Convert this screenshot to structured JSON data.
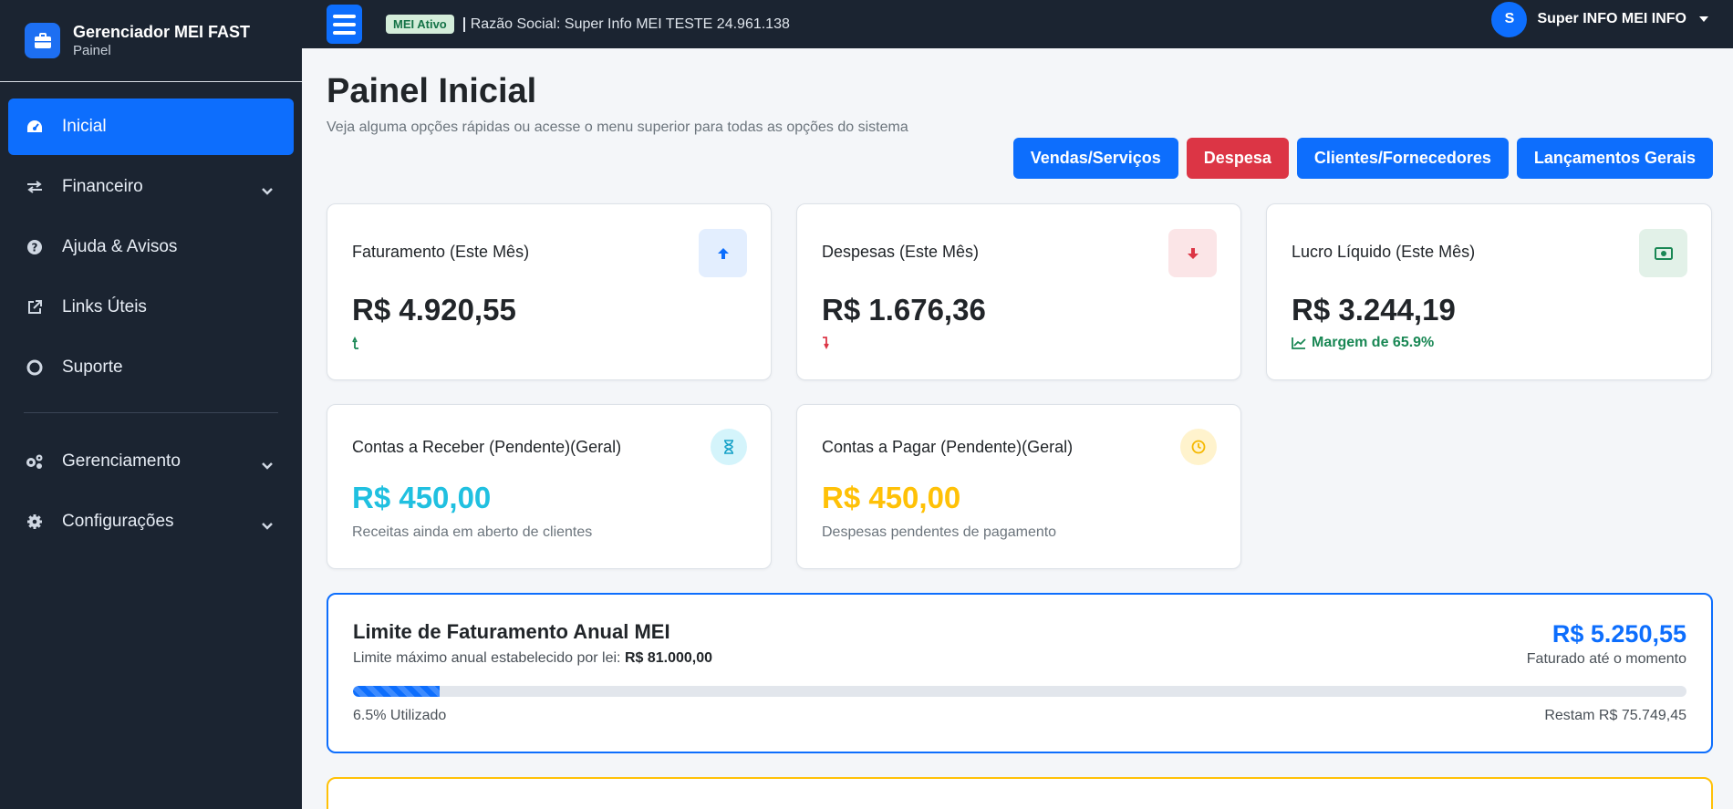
{
  "brand": {
    "title": "Gerenciador MEI FAST",
    "subtitle": "Painel"
  },
  "sidebar": {
    "items": [
      {
        "label": "Inicial",
        "icon": "gauge-icon",
        "active": true
      },
      {
        "label": "Financeiro",
        "icon": "exchange-icon",
        "dropdown": true
      },
      {
        "label": "Ajuda & Avisos",
        "icon": "question-icon"
      },
      {
        "label": "Links Úteis",
        "icon": "external-link-icon"
      },
      {
        "label": "Suporte",
        "icon": "lifebuoy-icon"
      },
      {
        "label": "Gerenciamento",
        "icon": "gears-icon",
        "dropdown": true
      },
      {
        "label": "Configurações",
        "icon": "gear-icon",
        "dropdown": true
      }
    ]
  },
  "topbar": {
    "status_badge": "MEI Ativo",
    "razao_social": "Razão Social: Super Info MEI TESTE 24.961.138",
    "user_initial": "S",
    "user_name": "Super INFO MEI INFO"
  },
  "header": {
    "title": "Painel Inicial",
    "description": "Veja alguma opções rápidas ou acesse o menu superior para todas as opções do sistema"
  },
  "actions": {
    "vendas": "Vendas/Serviços",
    "despesa": "Despesa",
    "clientes": "Clientes/Fornecedores",
    "lancamentos": "Lançamentos Gerais"
  },
  "cards": {
    "faturamento": {
      "label": "Faturamento (Este Mês)",
      "value": "R$ 4.920,55",
      "icon": "arrow-up-icon"
    },
    "despesas": {
      "label": "Despesas (Este Mês)",
      "value": "R$ 1.676,36",
      "icon": "arrow-down-icon"
    },
    "lucro": {
      "label": "Lucro Líquido (Este Mês)",
      "value": "R$ 3.244,19",
      "foot": "Margem de 65.9%",
      "icon": "money-bill-icon"
    },
    "receber": {
      "label": "Contas a Receber (Pendente)(Geral)",
      "value": "R$ 450,00",
      "foot": "Receitas ainda em aberto de clientes",
      "icon": "hourglass-icon"
    },
    "pagar": {
      "label": "Contas a Pagar (Pendente)(Geral)",
      "value": "R$ 450,00",
      "foot": "Despesas pendentes de pagamento",
      "icon": "clock-icon"
    }
  },
  "limit": {
    "title": "Limite de Faturamento Anual MEI",
    "subtitle_prefix": "Limite máximo anual estabelecido por lei: ",
    "subtitle_value": "R$ 81.000,00",
    "billed_value": "R$ 5.250,55",
    "billed_label": "Faturado até o momento",
    "used_percent": 6.5,
    "used_label": "6.5% Utilizado",
    "remaining_label": "Restam R$ 75.749,45"
  },
  "colors": {
    "primary": "#0d6efd",
    "danger": "#dc3545",
    "success": "#198754",
    "info": "#20c0e0",
    "warning": "#ffc107",
    "sidebar_bg": "#1b2431"
  }
}
